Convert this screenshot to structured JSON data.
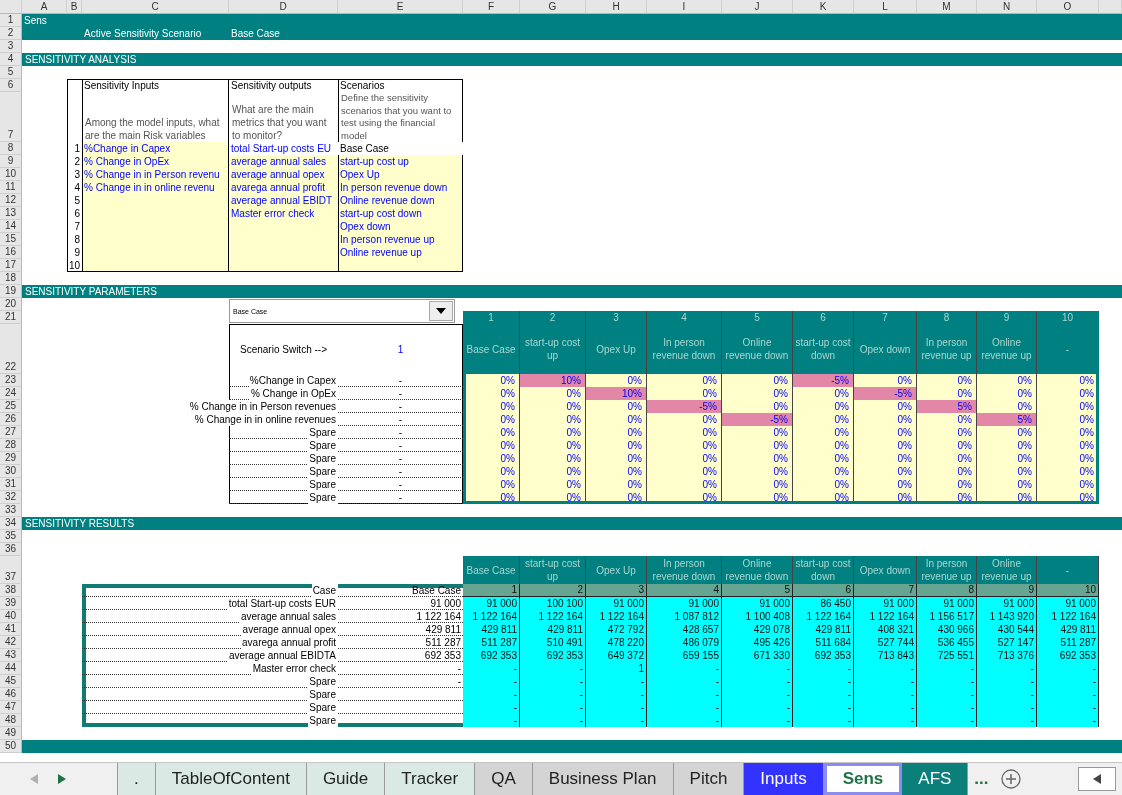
{
  "sheet": {
    "column_headers": [
      "A",
      "B",
      "C",
      "D",
      "E",
      "F",
      "G",
      "H",
      "I",
      "J",
      "K",
      "L",
      "M",
      "N",
      "O"
    ],
    "row_numbers": [
      "1",
      "2",
      "3",
      "4",
      "5",
      "6",
      "7",
      "8",
      "9",
      "10",
      "11",
      "12",
      "13",
      "14",
      "15",
      "16",
      "17",
      "18",
      "19",
      "20",
      "21",
      "22",
      "23",
      "24",
      "25",
      "26",
      "27",
      "28",
      "29",
      "30",
      "31",
      "32",
      "33",
      "34",
      "35",
      "36",
      "37",
      "38",
      "39",
      "40",
      "41",
      "42",
      "43",
      "44",
      "45",
      "46",
      "47",
      "48",
      "49",
      "50"
    ]
  },
  "title_band": {
    "sheet_label": "Sens",
    "active_label": "Active Sensitivity Scenario",
    "active_value": "Base Case"
  },
  "analysis": {
    "title": "SENSITIVITY ANALYSIS",
    "index": [
      "1",
      "2",
      "3",
      "4",
      "5",
      "6",
      "7",
      "8",
      "9",
      "10"
    ],
    "inputs": {
      "heading": "Sensitivity Inputs",
      "description": "Among the model inputs, what are the main Risk variables",
      "items": [
        "%Change in Capex",
        "% Change in OpEx",
        "% Change in in Person revenu",
        "% Change in in online revenu"
      ]
    },
    "outputs": {
      "heading": "Sensitivity outputs",
      "description": "What are the main metrics that you want to monitor?",
      "items": [
        "total Start-up costs EU",
        " average annual sales",
        " average annual opex",
        "avarega annual profit",
        "average annual EBIDT",
        "Master error check"
      ]
    },
    "scenarios": {
      "heading": "Scenarios",
      "description": "Define the sensitivity scenarios that you want to test using the financial model",
      "items": [
        {
          "text": "Base Case",
          "kind": "base"
        },
        {
          "text": "start-up cost up",
          "kind": "option"
        },
        {
          "text": "Opex Up",
          "kind": "option"
        },
        {
          "text": "In person revenue down",
          "kind": "option"
        },
        {
          "text": "Online revenue down",
          "kind": "option"
        },
        {
          "text": "start-up cost down",
          "kind": "option"
        },
        {
          "text": "Opex down",
          "kind": "option"
        },
        {
          "text": "In person revenue up",
          "kind": "option"
        },
        {
          "text": "Online revenue up",
          "kind": "option"
        }
      ]
    }
  },
  "parameters": {
    "title": "SENSITIVITY PARAMETERS",
    "dropdown": "Base Case",
    "switch_label": "Scenario Switch -->",
    "switch_value": "1",
    "scenarios": [
      {
        "number": "1",
        "name": "Base Case"
      },
      {
        "number": "2",
        "name": "start-up cost up"
      },
      {
        "number": "3",
        "name": "Opex Up"
      },
      {
        "number": "4",
        "name": "In person revenue down"
      },
      {
        "number": "5",
        "name": "Online revenue down"
      },
      {
        "number": "6",
        "name": "start-up cost down"
      },
      {
        "number": "7",
        "name": "Opex down"
      },
      {
        "number": "8",
        "name": "In person revenue up"
      },
      {
        "number": "9",
        "name": "Online revenue up"
      },
      {
        "number": "10",
        "name": "-"
      }
    ],
    "rows": [
      {
        "label": "%Change in Capex",
        "value": "-",
        "cells": [
          {
            "text": "0%",
            "highlighted": false
          },
          {
            "text": "10%",
            "highlighted": true
          },
          {
            "text": "0%",
            "highlighted": false
          },
          {
            "text": "0%",
            "highlighted": false
          },
          {
            "text": "0%",
            "highlighted": false
          },
          {
            "text": "-5%",
            "highlighted": true
          },
          {
            "text": "0%",
            "highlighted": false
          },
          {
            "text": "0%",
            "highlighted": false
          },
          {
            "text": "0%",
            "highlighted": false
          },
          {
            "text": "0%",
            "highlighted": false
          }
        ]
      },
      {
        "label": "% Change in OpEx",
        "value": "-",
        "cells": [
          {
            "text": "0%",
            "highlighted": false
          },
          {
            "text": "0%",
            "highlighted": false
          },
          {
            "text": "10%",
            "highlighted": true
          },
          {
            "text": "0%",
            "highlighted": false
          },
          {
            "text": "0%",
            "highlighted": false
          },
          {
            "text": "0%",
            "highlighted": false
          },
          {
            "text": "-5%",
            "highlighted": true
          },
          {
            "text": "0%",
            "highlighted": false
          },
          {
            "text": "0%",
            "highlighted": false
          },
          {
            "text": "0%",
            "highlighted": false
          }
        ]
      },
      {
        "label": "% Change in in Person revenues",
        "value": "-",
        "cells": [
          {
            "text": "0%",
            "highlighted": false
          },
          {
            "text": "0%",
            "highlighted": false
          },
          {
            "text": "0%",
            "highlighted": false
          },
          {
            "text": "-5%",
            "highlighted": true
          },
          {
            "text": "0%",
            "highlighted": false
          },
          {
            "text": "0%",
            "highlighted": false
          },
          {
            "text": "0%",
            "highlighted": false
          },
          {
            "text": "5%",
            "highlighted": true
          },
          {
            "text": "0%",
            "highlighted": false
          },
          {
            "text": "0%",
            "highlighted": false
          }
        ]
      },
      {
        "label": "% Change in in online revenues",
        "value": "-",
        "cells": [
          {
            "text": "0%",
            "highlighted": false
          },
          {
            "text": "0%",
            "highlighted": false
          },
          {
            "text": "0%",
            "highlighted": false
          },
          {
            "text": "0%",
            "highlighted": false
          },
          {
            "text": "-5%",
            "highlighted": true
          },
          {
            "text": "0%",
            "highlighted": false
          },
          {
            "text": "0%",
            "highlighted": false
          },
          {
            "text": "0%",
            "highlighted": false
          },
          {
            "text": "5%",
            "highlighted": true
          },
          {
            "text": "0%",
            "highlighted": false
          }
        ]
      },
      {
        "label": "Spare",
        "value": "-",
        "cells": [
          {
            "text": "0%",
            "highlighted": false
          },
          {
            "text": "0%",
            "highlighted": false
          },
          {
            "text": "0%",
            "highlighted": false
          },
          {
            "text": "0%",
            "highlighted": false
          },
          {
            "text": "0%",
            "highlighted": false
          },
          {
            "text": "0%",
            "highlighted": false
          },
          {
            "text": "0%",
            "highlighted": false
          },
          {
            "text": "0%",
            "highlighted": false
          },
          {
            "text": "0%",
            "highlighted": false
          },
          {
            "text": "0%",
            "highlighted": false
          }
        ]
      },
      {
        "label": "Spare",
        "value": "-",
        "cells": [
          {
            "text": "0%",
            "highlighted": false
          },
          {
            "text": "0%",
            "highlighted": false
          },
          {
            "text": "0%",
            "highlighted": false
          },
          {
            "text": "0%",
            "highlighted": false
          },
          {
            "text": "0%",
            "highlighted": false
          },
          {
            "text": "0%",
            "highlighted": false
          },
          {
            "text": "0%",
            "highlighted": false
          },
          {
            "text": "0%",
            "highlighted": false
          },
          {
            "text": "0%",
            "highlighted": false
          },
          {
            "text": "0%",
            "highlighted": false
          }
        ]
      },
      {
        "label": "Spare",
        "value": "-",
        "cells": [
          {
            "text": "0%",
            "highlighted": false
          },
          {
            "text": "0%",
            "highlighted": false
          },
          {
            "text": "0%",
            "highlighted": false
          },
          {
            "text": "0%",
            "highlighted": false
          },
          {
            "text": "0%",
            "highlighted": false
          },
          {
            "text": "0%",
            "highlighted": false
          },
          {
            "text": "0%",
            "highlighted": false
          },
          {
            "text": "0%",
            "highlighted": false
          },
          {
            "text": "0%",
            "highlighted": false
          },
          {
            "text": "0%",
            "highlighted": false
          }
        ]
      },
      {
        "label": "Spare",
        "value": "-",
        "cells": [
          {
            "text": "0%",
            "highlighted": false
          },
          {
            "text": "0%",
            "highlighted": false
          },
          {
            "text": "0%",
            "highlighted": false
          },
          {
            "text": "0%",
            "highlighted": false
          },
          {
            "text": "0%",
            "highlighted": false
          },
          {
            "text": "0%",
            "highlighted": false
          },
          {
            "text": "0%",
            "highlighted": false
          },
          {
            "text": "0%",
            "highlighted": false
          },
          {
            "text": "0%",
            "highlighted": false
          },
          {
            "text": "0%",
            "highlighted": false
          }
        ]
      },
      {
        "label": "Spare",
        "value": "-",
        "cells": [
          {
            "text": "0%",
            "highlighted": false
          },
          {
            "text": "0%",
            "highlighted": false
          },
          {
            "text": "0%",
            "highlighted": false
          },
          {
            "text": "0%",
            "highlighted": false
          },
          {
            "text": "0%",
            "highlighted": false
          },
          {
            "text": "0%",
            "highlighted": false
          },
          {
            "text": "0%",
            "highlighted": false
          },
          {
            "text": "0%",
            "highlighted": false
          },
          {
            "text": "0%",
            "highlighted": false
          },
          {
            "text": "0%",
            "highlighted": false
          }
        ]
      },
      {
        "label": "Spare",
        "value": "-",
        "cells": [
          {
            "text": "0%",
            "highlighted": false
          },
          {
            "text": "0%",
            "highlighted": false
          },
          {
            "text": "0%",
            "highlighted": false
          },
          {
            "text": "0%",
            "highlighted": false
          },
          {
            "text": "0%",
            "highlighted": false
          },
          {
            "text": "0%",
            "highlighted": false
          },
          {
            "text": "0%",
            "highlighted": false
          },
          {
            "text": "0%",
            "highlighted": false
          },
          {
            "text": "0%",
            "highlighted": false
          },
          {
            "text": "0%",
            "highlighted": false
          }
        ]
      }
    ]
  },
  "results": {
    "title": "SENSITIVITY RESULTS",
    "case_label": "Case",
    "case_value": "Base Case",
    "scenarios": [
      {
        "name": "Base Case",
        "number": "1"
      },
      {
        "name": "start-up cost up",
        "number": "2"
      },
      {
        "name": "Opex Up",
        "number": "3"
      },
      {
        "name": "In person revenue down",
        "number": "4"
      },
      {
        "name": "Online revenue down",
        "number": "5"
      },
      {
        "name": "start-up cost down",
        "number": "6"
      },
      {
        "name": "Opex down",
        "number": "7"
      },
      {
        "name": "In person revenue up",
        "number": "8"
      },
      {
        "name": "Online revenue up",
        "number": "9"
      },
      {
        "name": "-",
        "number": "10"
      }
    ],
    "rows": [
      {
        "label": "total Start-up costs EUR",
        "base": "91 000",
        "values": [
          "91 000",
          "100 100",
          "91 000",
          "91 000",
          "91 000",
          "86 450",
          "91 000",
          "91 000",
          "91 000",
          "91 000"
        ]
      },
      {
        "label": "average annual sales",
        "base": "1 122 164",
        "values": [
          "1 122 164",
          "1 122 164",
          "1 122 164",
          "1 087 812",
          "1 100 408",
          "1 122 164",
          "1 122 164",
          "1 156 517",
          "1 143 920",
          "1 122 164"
        ]
      },
      {
        "label": "average annual opex",
        "base": "429 811",
        "values": [
          "429 811",
          "429 811",
          "472 792",
          "428 657",
          "429 078",
          "429 811",
          "408 321",
          "430 966",
          "430 544",
          "429 811"
        ]
      },
      {
        "label": "avarega annual profit",
        "base": "511 287",
        "values": [
          "511 287",
          "510 491",
          "478 220",
          "486 079",
          "495 426",
          "511 684",
          "527 744",
          "536 455",
          "527 147",
          "511 287"
        ]
      },
      {
        "label": "average annual EBIDTA",
        "base": "692 353",
        "values": [
          "692 353",
          "692 353",
          "649 372",
          "659 155",
          "671 330",
          "692 353",
          "713 843",
          "725 551",
          "713 376",
          "692 353"
        ]
      },
      {
        "label": "Master error check",
        "base": "-",
        "values": [
          "-",
          "-",
          "1",
          "-",
          "-",
          "-",
          "-",
          "-",
          "-",
          "-"
        ]
      },
      {
        "label": "Spare",
        "base": "-",
        "values": [
          "-",
          "-",
          "-",
          "-",
          "-",
          "-",
          "-",
          "-",
          "-",
          "-"
        ]
      },
      {
        "label": "Spare",
        "values": [
          "-",
          "-",
          "-",
          "-",
          "-",
          "-",
          "-",
          "-",
          "-",
          "-"
        ]
      },
      {
        "label": "Spare",
        "values": [
          "-",
          "-",
          "-",
          "-",
          "-",
          "-",
          "-",
          "-",
          "-",
          "-"
        ]
      },
      {
        "label": "Spare",
        "values": [
          "-",
          "-",
          "-",
          "-",
          "-",
          "-",
          "-",
          "-",
          "-",
          "-"
        ]
      }
    ]
  },
  "tabs": [
    {
      "label": ".",
      "color": "#dbe9e4",
      "selected": false
    },
    {
      "label": "TableOfContent",
      "color": "#dbe9e4",
      "selected": false
    },
    {
      "label": "Guide",
      "color": "#dbe9e4",
      "selected": false
    },
    {
      "label": "Tracker",
      "color": "#dbe9e4",
      "selected": false
    },
    {
      "label": "QA",
      "color": "#d4d4d4",
      "selected": false
    },
    {
      "label": "Business Plan",
      "color": "#d4d4d4",
      "selected": false
    },
    {
      "label": "Pitch",
      "color": "#d4d4d4",
      "selected": false
    },
    {
      "label": "Inputs",
      "color": "#3333ff",
      "selected": false
    },
    {
      "label": "Sens",
      "color": "#8a8cf0",
      "selected": true
    },
    {
      "label": "AFS",
      "color": "#0b7f7a",
      "selected": false
    }
  ],
  "more_tabs": "..."
}
